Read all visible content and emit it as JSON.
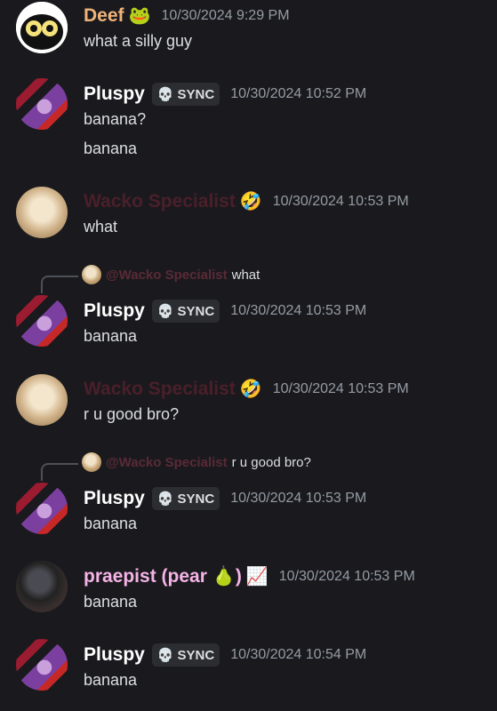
{
  "messages": [
    {
      "author": "Deef",
      "author_color": "#f0b27a",
      "badge_emoji": "🐸",
      "timestamp": "10/30/2024 9:29 PM",
      "lines": [
        "what a silly guy"
      ]
    },
    {
      "author": "Pluspy",
      "author_color": "#ffffff",
      "tag_icon": "skull-icon",
      "tag": "SYNC",
      "timestamp": "10/30/2024 10:52 PM",
      "lines": [
        "banana?",
        "banana"
      ]
    },
    {
      "author": "Wacko Specialist",
      "author_color": "#4a1f2a",
      "badge_emoji": "🤣",
      "timestamp": "10/30/2024 10:53 PM",
      "lines": [
        "what"
      ]
    },
    {
      "reply_to": {
        "author": "@Wacko Specialist",
        "text": "what"
      },
      "author": "Pluspy",
      "tag": "SYNC",
      "timestamp": "10/30/2024 10:53 PM",
      "lines": [
        "banana"
      ]
    },
    {
      "author": "Wacko Specialist",
      "badge_emoji": "🤣",
      "timestamp": "10/30/2024 10:53 PM",
      "lines": [
        "r u good bro?"
      ]
    },
    {
      "reply_to": {
        "author": "@Wacko Specialist",
        "text": "r u good bro?"
      },
      "author": "Pluspy",
      "tag": "SYNC",
      "timestamp": "10/30/2024 10:53 PM",
      "lines": [
        "banana"
      ]
    },
    {
      "author": "praepist (pear 🍐)",
      "author_color": "#f5b3e6",
      "badge_emoji": "📈",
      "timestamp": "10/30/2024 10:53 PM",
      "lines": [
        "banana"
      ]
    },
    {
      "author": "Pluspy",
      "tag": "SYNC",
      "timestamp": "10/30/2024 10:54 PM",
      "lines": [
        "banana"
      ]
    }
  ]
}
